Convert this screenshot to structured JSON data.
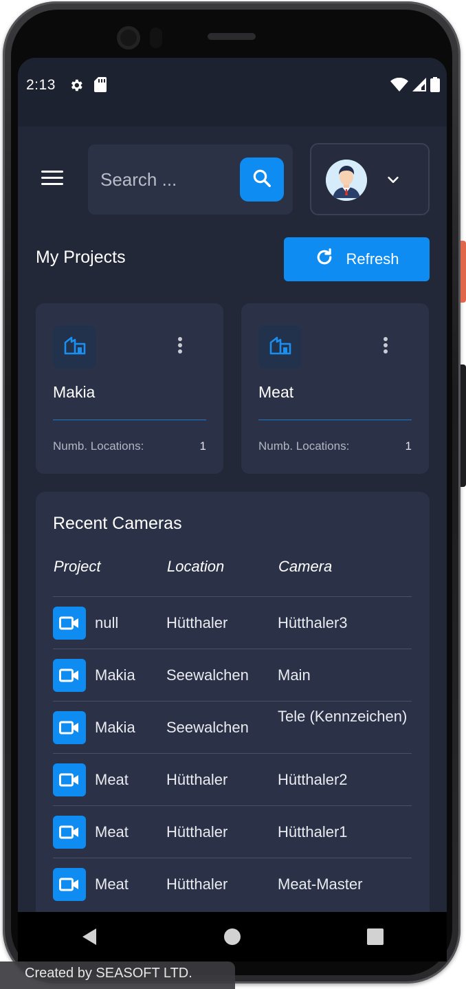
{
  "status_bar": {
    "time": "2:13"
  },
  "header": {
    "search_placeholder": "Search ...",
    "profile_dropdown": "user-avatar"
  },
  "projects_section": {
    "title": "My Projects",
    "refresh_label": "Refresh"
  },
  "projects": [
    {
      "name": "Makia",
      "locations_label": "Numb. Locations:",
      "locations_count": "1"
    },
    {
      "name": "Meat",
      "locations_label": "Numb. Locations:",
      "locations_count": "1"
    }
  ],
  "recent_cameras": {
    "title": "Recent Cameras",
    "columns": {
      "project": "Project",
      "location": "Location",
      "camera": "Camera"
    },
    "rows": [
      {
        "project": "null",
        "location": "Hütthaler",
        "camera": "Hütthaler3"
      },
      {
        "project": "Makia",
        "location": "Seewalchen",
        "camera": "Main"
      },
      {
        "project": "Makia",
        "location": "Seewalchen",
        "camera": "Tele (Kennzeichen)"
      },
      {
        "project": "Meat",
        "location": "Hütthaler",
        "camera": "Hütthaler2"
      },
      {
        "project": "Meat",
        "location": "Hütthaler",
        "camera": "Hütthaler1"
      },
      {
        "project": "Meat",
        "location": "Hütthaler",
        "camera": "Meat-Master"
      }
    ]
  },
  "watermark": "Created by SEASOFT LTD.",
  "colors": {
    "accent": "#0e8cf2",
    "background": "#222838",
    "card": "#2b3146"
  }
}
